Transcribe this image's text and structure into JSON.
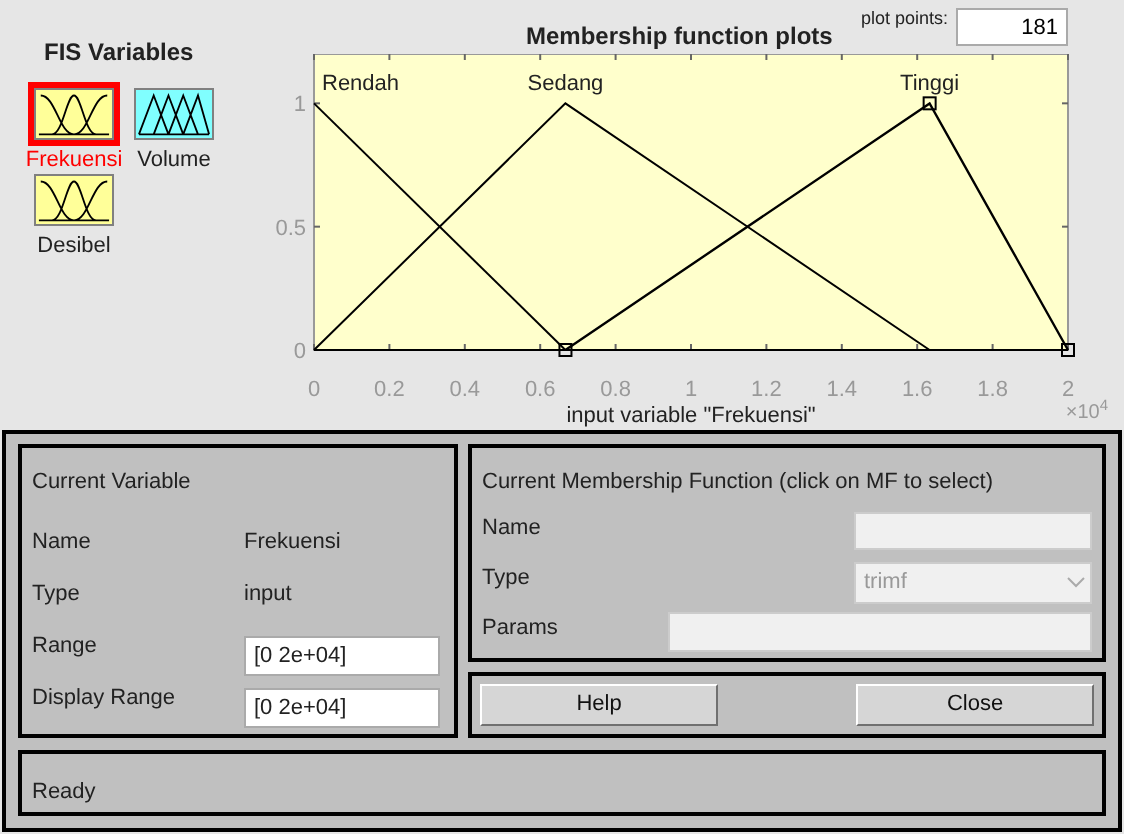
{
  "fis_variables": {
    "title": "FIS Variables",
    "items": [
      {
        "name": "Frekuensi",
        "kind": "input",
        "selected": true
      },
      {
        "name": "Volume",
        "kind": "output",
        "selected": false
      },
      {
        "name": "Desibel",
        "kind": "input",
        "selected": false
      }
    ]
  },
  "plot": {
    "title": "Membership function plots",
    "plot_points_label": "plot points:",
    "plot_points": "181",
    "exponent": "×10$^{4}$",
    "chart_data": {
      "type": "line",
      "xlabel": "input variable \"Frekuensi\"",
      "x": [
        0,
        0.667,
        1.633,
        2
      ],
      "xlim": [
        0,
        2
      ],
      "ylim": [
        0,
        1.2
      ],
      "xticks": [
        0,
        0.2,
        0.4,
        0.6,
        0.8,
        1,
        1.2,
        1.4,
        1.6,
        1.8,
        2
      ],
      "yticks": [
        0,
        0.5,
        1
      ],
      "series": [
        {
          "name": "Rendah",
          "color": "#000000",
          "values": [
            1,
            0,
            null,
            null
          ]
        },
        {
          "name": "Sedang",
          "color": "#000000",
          "values": [
            0,
            1,
            0,
            null
          ]
        },
        {
          "name": "Tinggi",
          "color": "#000000",
          "values": [
            null,
            0,
            1,
            0
          ]
        }
      ]
    },
    "mf_states": [
      {
        "selected": false
      },
      {
        "selected": false
      },
      {
        "selected": true
      }
    ]
  },
  "current_variable": {
    "title": "Current Variable",
    "rows": [
      {
        "label": "Name",
        "kind": "text",
        "value": "Frekuensi"
      },
      {
        "label": "Type",
        "kind": "text",
        "value": "input"
      },
      {
        "label": "Range",
        "kind": "field",
        "value": "[0 2e+04]"
      },
      {
        "label": "Display Range",
        "kind": "field",
        "value": "[0 2e+04]"
      }
    ]
  },
  "current_mf": {
    "title": "Current Membership Function (click on MF to select)",
    "name_label": "Name",
    "type_label": "Type",
    "type_value": "trimf",
    "params_label": "Params",
    "disabled": true
  },
  "buttons": [
    "Help",
    "Close"
  ],
  "status": "Ready"
}
